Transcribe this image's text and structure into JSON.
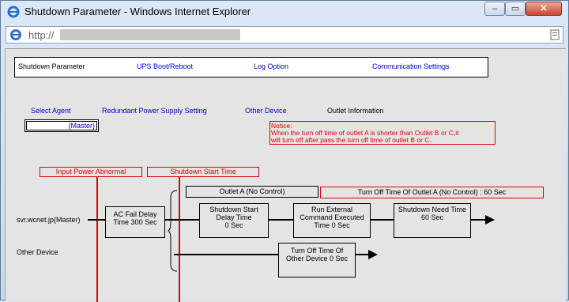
{
  "window": {
    "title": "Shutdown Parameter - Windows Internet Explorer",
    "address": "http://",
    "min_label": "–",
    "max_label": "▭",
    "close_label": "✕"
  },
  "nav": {
    "items": [
      "Shutdown Parameter",
      "UPS Boot/Reboot",
      "Log Option",
      "Communication Settings"
    ]
  },
  "sub": {
    "select_agent": "Select Agent",
    "redundant": "Redundant Power Supply Setting",
    "other_device": "Other Device",
    "outlet_info": "Outlet Information"
  },
  "agent": {
    "value": "(Master)"
  },
  "notice": {
    "title": "Notice:",
    "line1": "When the turn off time of outlet A is shorter than Outlet B or C,it",
    "line2": "will turn off after pass the turn off time of outlet B or C."
  },
  "diagram": {
    "input_power_abnormal": "Input Power Abnormal",
    "shutdown_start_time": "Shutdown Start Time",
    "outlet_a": "Outlet A (No Control)",
    "turn_off_outlet_a": "Turn Off Time Of Outlet A (No Control) : 60 Sec",
    "master_label": "svr.wcnet.jp(Master)",
    "other_device_label": "Other Device",
    "ac_fail": [
      "AC Fail Delay",
      "Time 300 Sec"
    ],
    "shutdown_delay": [
      "Shutdown Start",
      "Delay Time",
      "0 Sec"
    ],
    "run_external": [
      "Run External",
      "Command Executed",
      "Time 0 Sec"
    ],
    "shutdown_need": [
      "Shutdown Need Time",
      "60 Sec"
    ],
    "turn_off_other": [
      "Turn Off Time Of",
      "Other Device 0 Sec"
    ]
  }
}
